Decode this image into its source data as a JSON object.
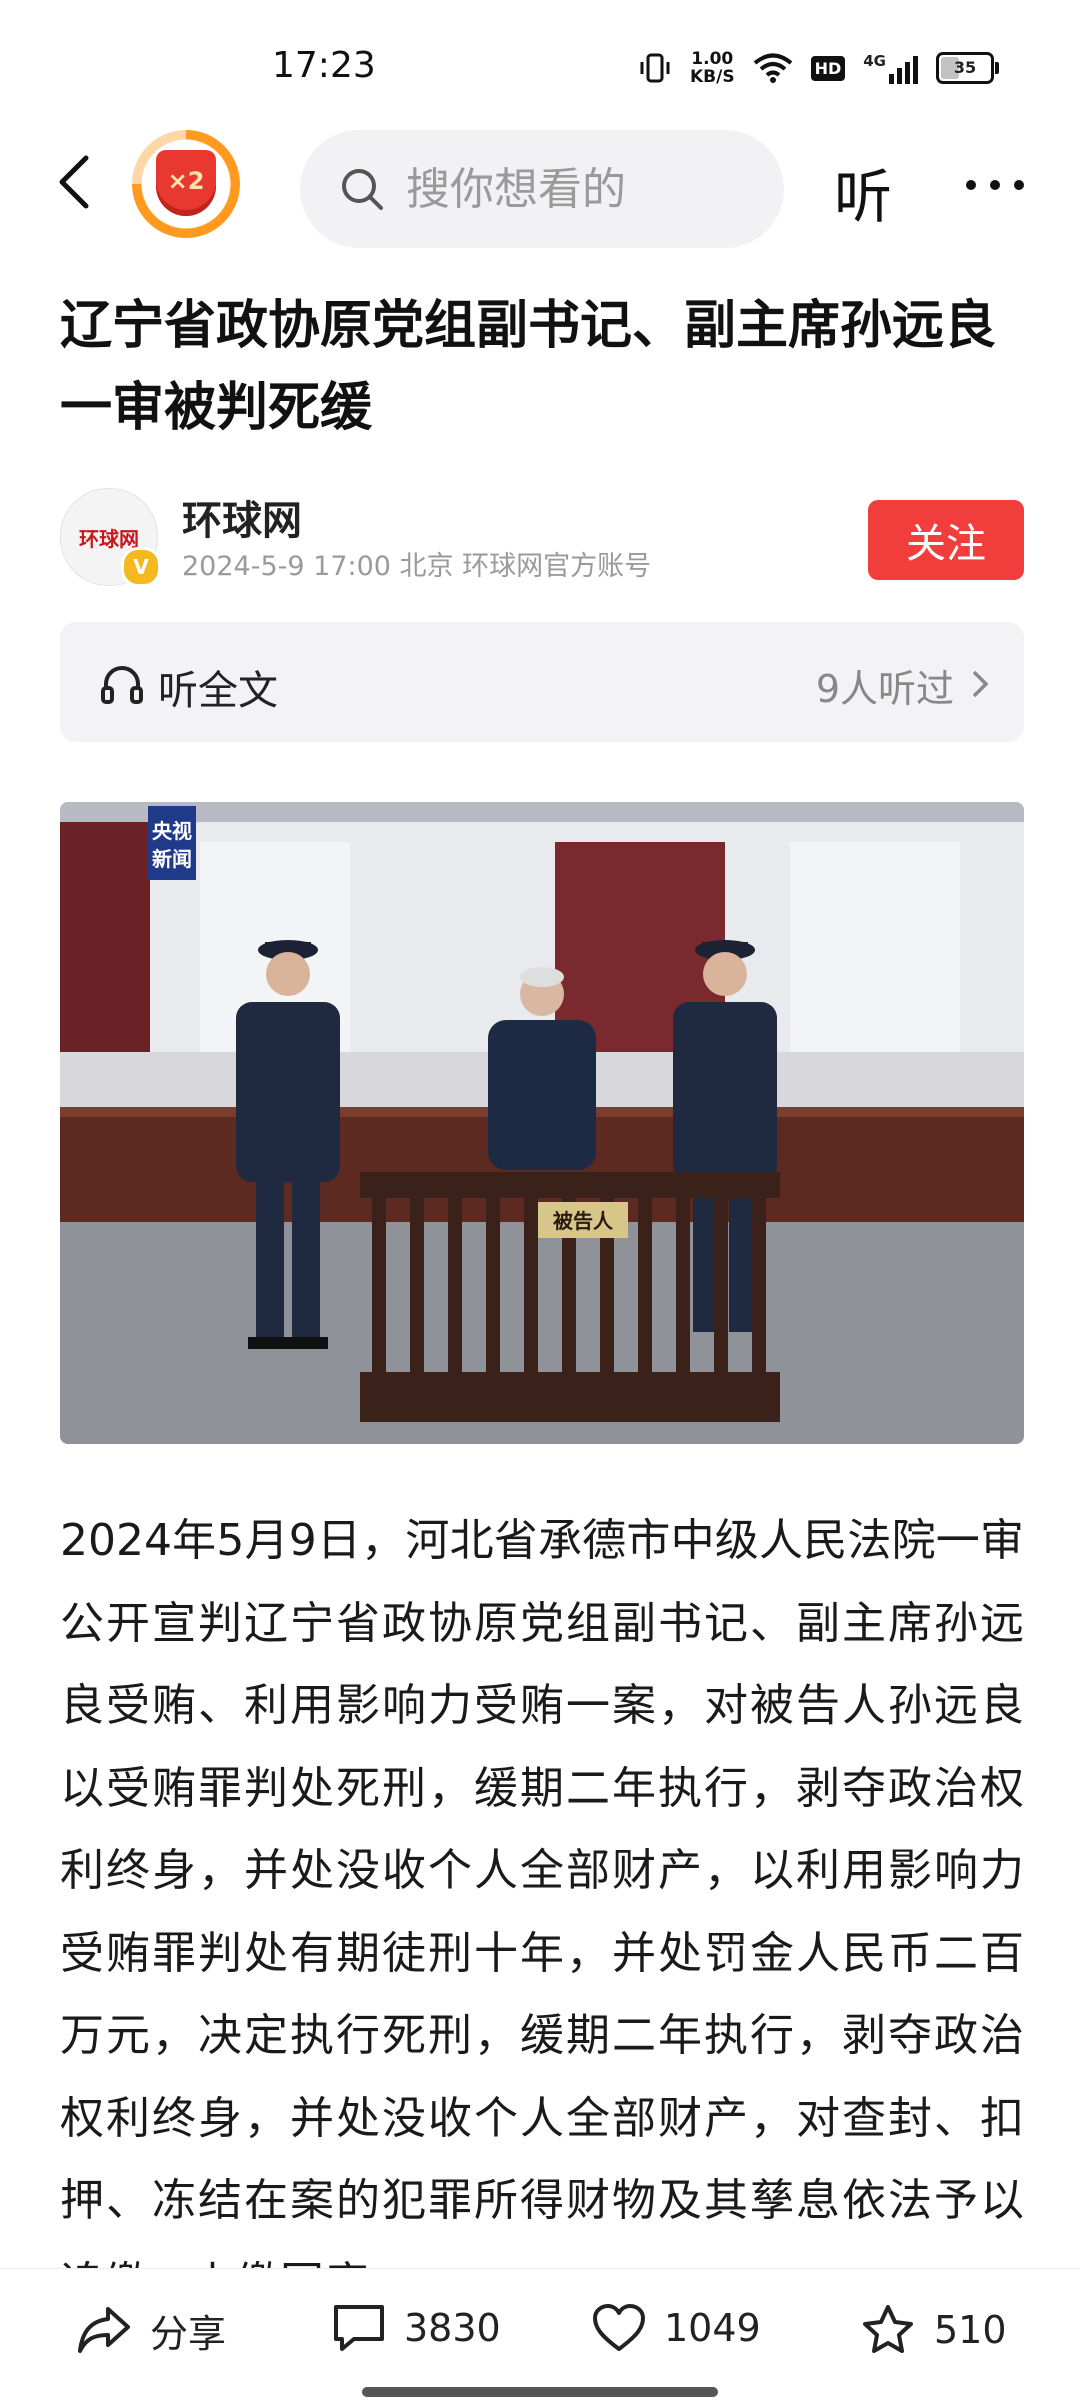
{
  "status": {
    "time": "17:23",
    "net_speed_value": "1.00",
    "net_speed_unit": "KB/S",
    "hd_label": "HD",
    "signal_label": "4G",
    "battery": "35"
  },
  "nav": {
    "badge_text": "×2",
    "search_placeholder": "搜你想看的",
    "listen_label": "听"
  },
  "article": {
    "title": "辽宁省政协原党组副书记、副主席孙远良一审被判死缓",
    "author_name": "环球网",
    "avatar_logo": "环球网",
    "meta": "2024-5-9  17:00  北京  环球网官方账号",
    "follow_label": "关注",
    "listen_full": "听全文",
    "listen_count": "9人听过",
    "photo": {
      "watermark_line1": "央视",
      "watermark_line2": "新闻",
      "dock_sign": "被告人"
    },
    "body": "2024年5月9日，河北省承德市中级人民法院一审公开宣判辽宁省政协原党组副书记、副主席孙远良受贿、利用影响力受贿一案，对被告人孙远良以受贿罪判处死刑，缓期二年执行，剥夺政治权利终身，并处没收个人全部财产，以利用影响力受贿罪判处有期徒刑十年，并处罚金人民币二百万元，决定执行死刑，缓期二年执行，剥夺政治权利终身，并处没收个人全部财产，对查封、扣押、冻结在案的犯罪所得财物及其孳息依法予以追缴，上缴国库。"
  },
  "actions": {
    "share_label": "分享",
    "comments": "3830",
    "likes": "1049",
    "favorites": "510"
  }
}
